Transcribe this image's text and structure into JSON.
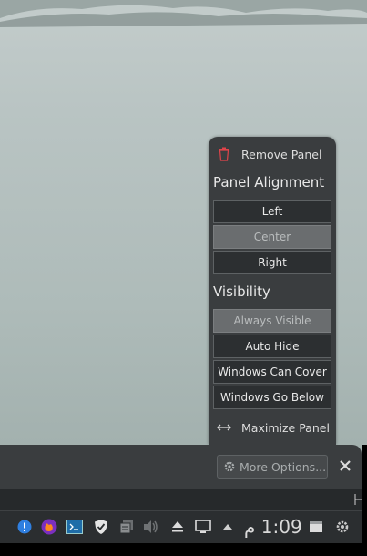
{
  "menu": {
    "remove_panel": "Remove Panel",
    "alignment_title": "Panel Alignment",
    "alignment_options": [
      "Left",
      "Center",
      "Right"
    ],
    "alignment_selected": "Center",
    "visibility_title": "Visibility",
    "visibility_options": [
      "Always Visible",
      "Auto Hide",
      "Windows Can Cover",
      "Windows Go Below"
    ],
    "visibility_selected": "Always Visible",
    "maximize_panel": "Maximize Panel"
  },
  "toolbar": {
    "more_options_label": "More Options..."
  },
  "taskbar": {
    "clock": "1:09 م",
    "icons": [
      "info-icon",
      "firefox-icon",
      "terminal-icon",
      "shield-icon",
      "clipboard-icon",
      "volume-icon",
      "eject-icon",
      "display-icon",
      "arrow-up-icon",
      "show-desktop-icon",
      "gear-icon"
    ]
  },
  "colors": {
    "accent_red": "#e0444a",
    "menu_bg": "#3a3d3f"
  }
}
